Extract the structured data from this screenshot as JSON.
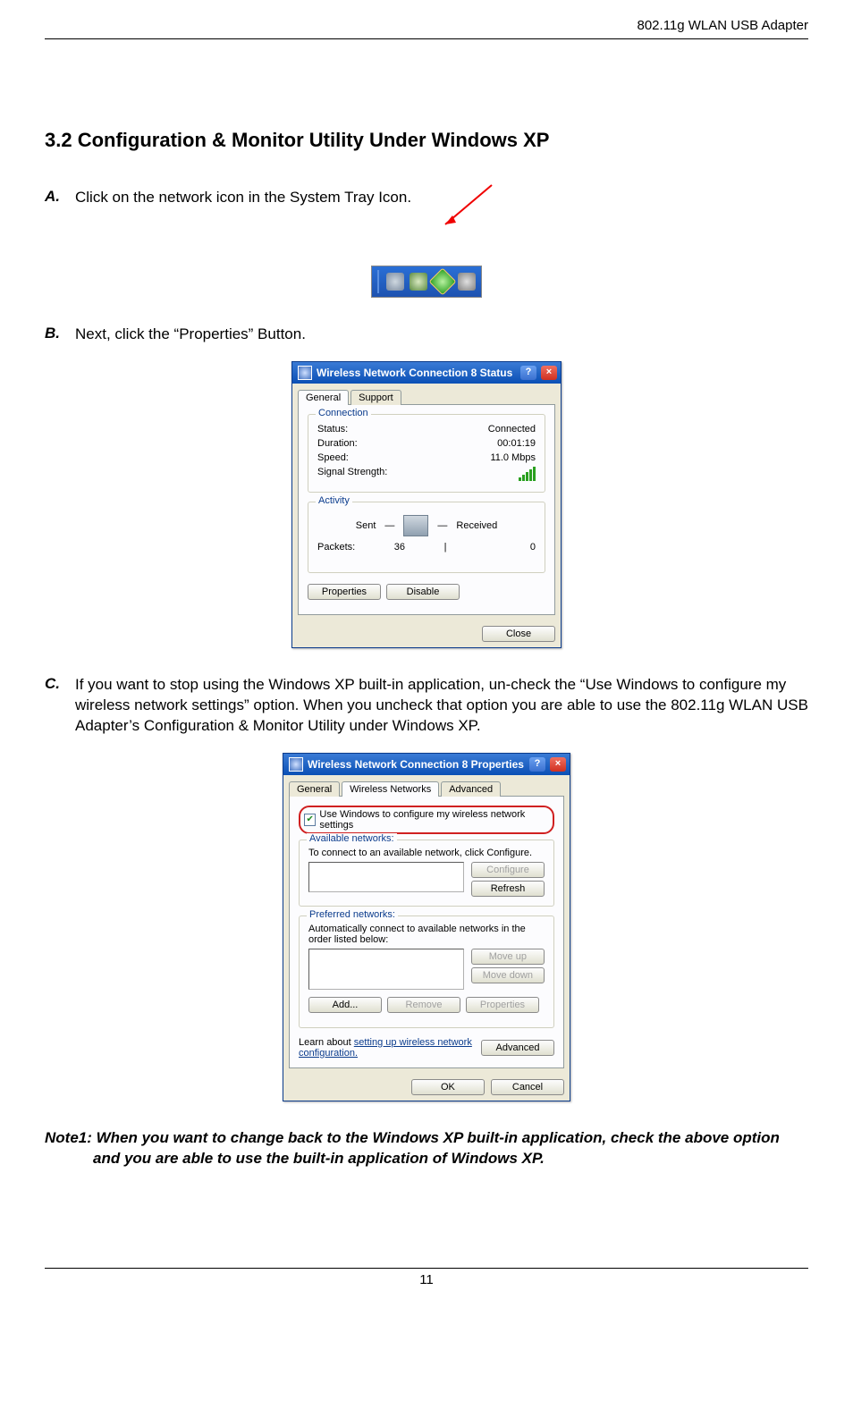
{
  "doc": {
    "header": "802.11g WLAN USB Adapter",
    "section_title": "3.2 Configuration & Monitor Utility Under Windows XP",
    "page_number": "11"
  },
  "steps": {
    "a_label": "A.",
    "a_text": "Click on the network icon in the System Tray Icon.",
    "b_label": "B.",
    "b_text": "Next, click the “Properties” Button.",
    "c_label": "C.",
    "c_text": "If you want to stop using the Windows XP built-in application, un-check the “Use Windows to configure my wireless network settings” option. When you uncheck that option you are able to use the 802.11g WLAN USB Adapter’s Configuration & Monitor Utility under Windows XP."
  },
  "note1": "Note1: When you want to change back to the Windows XP built-in application, check the above option and you are able to use the built-in application of Windows XP.",
  "dlg_status": {
    "title": "Wireless Network Connection 8 Status",
    "tab_general": "General",
    "tab_support": "Support",
    "grp_connection": "Connection",
    "lbl_status": "Status:",
    "val_status": "Connected",
    "lbl_duration": "Duration:",
    "val_duration": "00:01:19",
    "lbl_speed": "Speed:",
    "val_speed": "11.0 Mbps",
    "lbl_signal": "Signal Strength:",
    "grp_activity": "Activity",
    "lbl_sent": "Sent",
    "lbl_received": "Received",
    "lbl_packets": "Packets:",
    "val_sent": "36",
    "val_received": "0",
    "btn_properties": "Properties",
    "btn_disable": "Disable",
    "btn_close": "Close"
  },
  "dlg_props": {
    "title": "Wireless Network Connection 8 Properties",
    "tab_general": "General",
    "tab_wireless": "Wireless Networks",
    "tab_advanced": "Advanced",
    "chk_label": "Use Windows to configure my wireless network settings",
    "grp_available": "Available networks:",
    "available_hint": "To connect to an available network, click Configure.",
    "btn_configure": "Configure",
    "btn_refresh": "Refresh",
    "grp_preferred": "Preferred networks:",
    "preferred_hint": "Automatically connect to available networks in the order listed below:",
    "btn_moveup": "Move up",
    "btn_movedown": "Move down",
    "btn_add": "Add...",
    "btn_remove": "Remove",
    "btn_properties": "Properties",
    "learn_text": "Learn about ",
    "learn_link": "setting up wireless network configuration.",
    "btn_advanced": "Advanced",
    "btn_ok": "OK",
    "btn_cancel": "Cancel"
  }
}
